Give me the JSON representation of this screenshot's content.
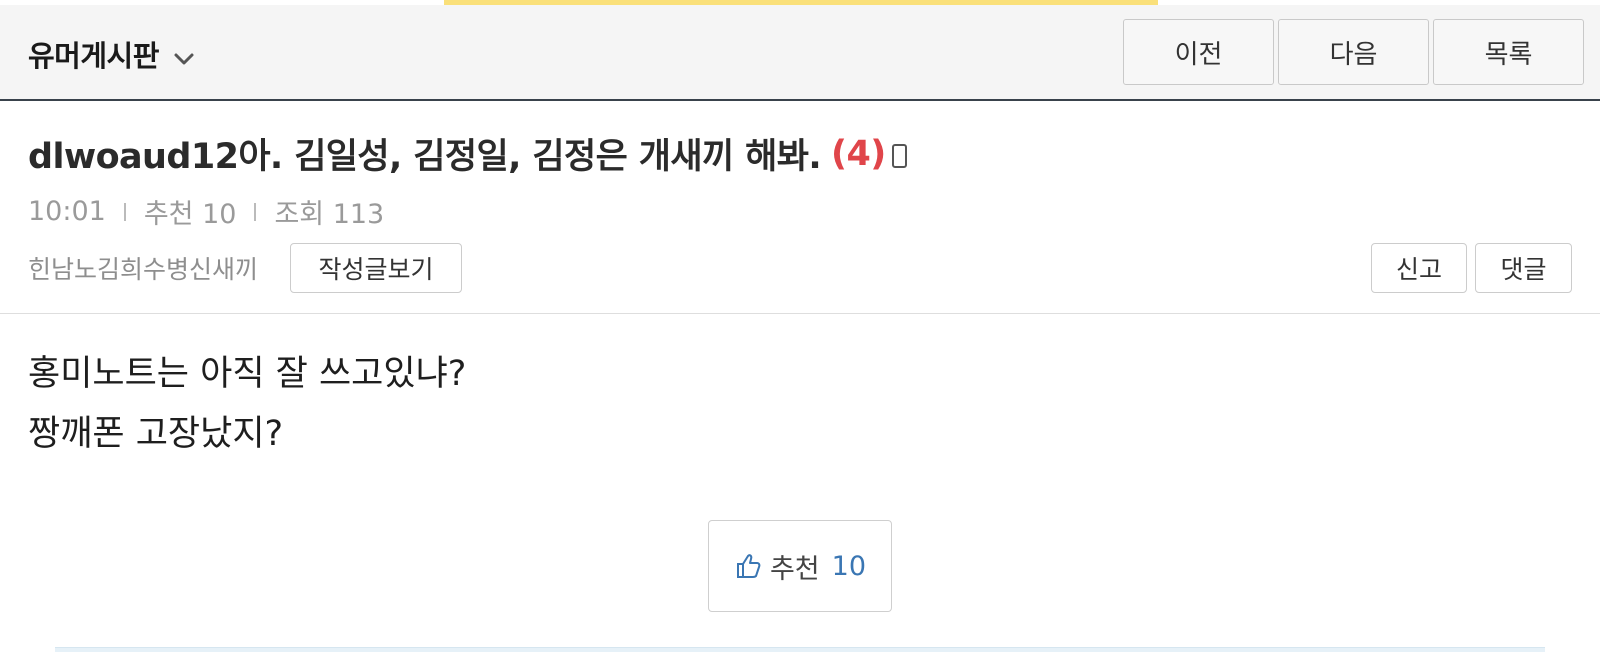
{
  "header": {
    "board_title": "유머게시판",
    "prev_label": "이전",
    "next_label": "다음",
    "list_label": "목록"
  },
  "post": {
    "title": "dlwoaud12아. 김일성, 김정일, 김정은 개새끼 해봐.",
    "comment_count": "(4)",
    "time": "10:01",
    "recommend_text": "추천 10",
    "views_text": "조회 113",
    "author": "힌남노김희수병신새끼",
    "view_posts_label": "작성글보기",
    "report_label": "신고",
    "comment_label": "댓글",
    "body_lines": [
      "홍미노트는 아직 잘 쓰고있냐?",
      "짱깨폰 고장났지?"
    ]
  },
  "recommend_button": {
    "label": "추천",
    "count": "10"
  },
  "colors": {
    "accent_count": "#e0454a",
    "recommend_number": "#3a76b3",
    "top_strip": "#fae07a",
    "header_border": "#39424b"
  },
  "icons": {
    "board_dropdown": "chevron-down-icon",
    "mobile": "mobile-phone-icon",
    "recommend": "thumbs-up-icon"
  }
}
